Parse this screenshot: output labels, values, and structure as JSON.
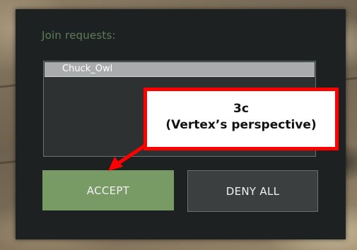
{
  "dialog": {
    "title": "Join requests:",
    "requests": [
      "Chuck_Owl"
    ],
    "accept_label": "ACCEPT",
    "deny_all_label": "DENY ALL"
  },
  "annotation": {
    "line1": "3c",
    "line2": "(Vertex’s perspective)",
    "color": "#ff0000",
    "arrow_icon": "arrow-icon"
  },
  "colors": {
    "panel": "#1d2121",
    "title_text": "#5e7c5a",
    "selected_item": "#a9abad",
    "accept_button": "#789a64",
    "deny_button": "#3b3f40"
  }
}
